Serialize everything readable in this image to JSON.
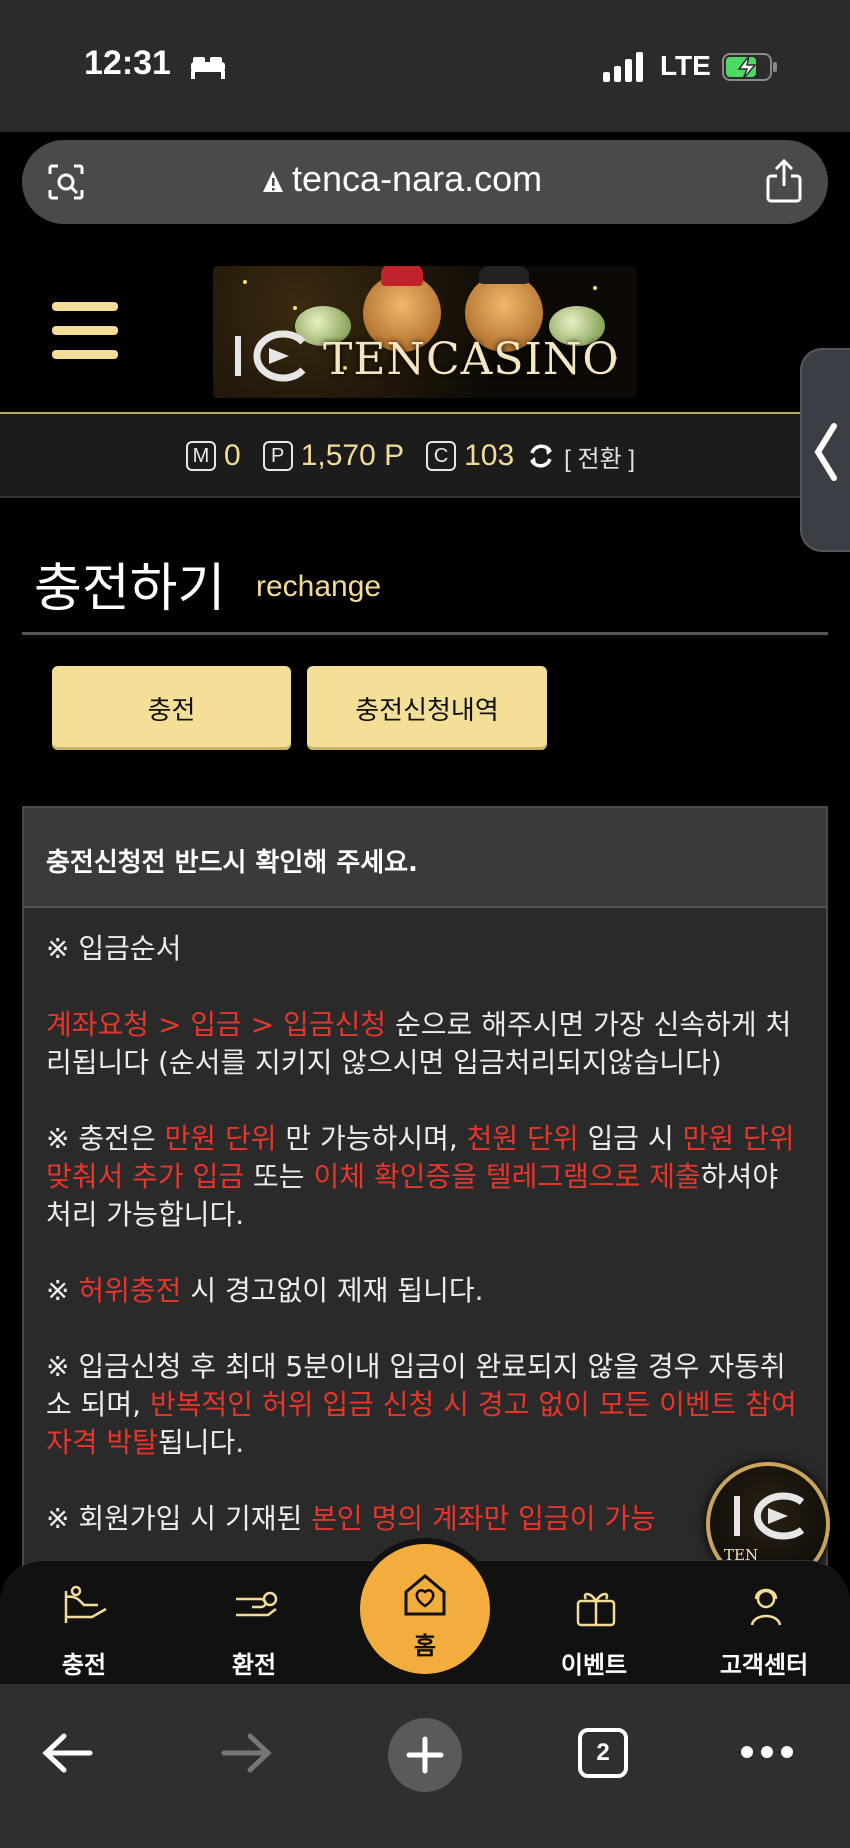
{
  "status_bar": {
    "time": "12:31",
    "network": "LTE"
  },
  "browser": {
    "url": "tenca-nara.com",
    "tab_count": "2"
  },
  "header": {
    "logo_text": "TENCASINO"
  },
  "points": {
    "m_label": "M",
    "m_value": "0",
    "p_label": "P",
    "p_value": "1,570 P",
    "c_label": "C",
    "c_value": "103",
    "convert_label": "[ 전환 ]"
  },
  "page": {
    "title": "충전하기",
    "subtitle": "rechange"
  },
  "tabs": {
    "charge": "충전",
    "history": "충전신청내역"
  },
  "notice": {
    "heading": "충전신청전 반드시 확인해 주세요.",
    "p1": "※ 입금순서",
    "p2_red": "계좌요청 > 입금 > 입금신청",
    "p2_rest": " 순으로 해주시면 가장 신속하게 처리됩니다 (순서를 지키지 않으시면 입금처리되지않습니다)",
    "p3_a": "※ 충전은 ",
    "p3_b_red": "만원 단위",
    "p3_c": " 만 가능하시며, ",
    "p3_d_red": "천원 단위",
    "p3_e": " 입금 시 ",
    "p3_f_red": "만원 단위 맞춰서 추가 입금",
    "p3_g": " 또는 ",
    "p3_h_red": "이체 확인증을 텔레그램으로 제출",
    "p3_i": "하셔야 처리 가능합니다.",
    "p4_a": "※ ",
    "p4_b_red": "허위충전",
    "p4_c": " 시 경고없이 제재 됩니다.",
    "p5_a": "※ 입금신청 후 최대 5분이내 입금이 완료되지 않을 경우 자동취소 되며, ",
    "p5_b_red": "반복적인 허위 입금 신청 시 경고 없이 모든 이벤트 참여 자격 박탈",
    "p5_c": "됩니다.",
    "p6_a": "※ 회원가입 시 기재된 ",
    "p6_b_red": "본인 명의 계좌만 입금이 가능"
  },
  "float_logo": {
    "text": "TEN CASINO"
  },
  "bottom_nav": {
    "charge": "충전",
    "exchange": "환전",
    "home": "홈",
    "event": "이벤트",
    "support": "고객센터"
  },
  "colors": {
    "gold": "#f3dc95",
    "red": "#e8352b",
    "home": "#f2ad3c"
  }
}
